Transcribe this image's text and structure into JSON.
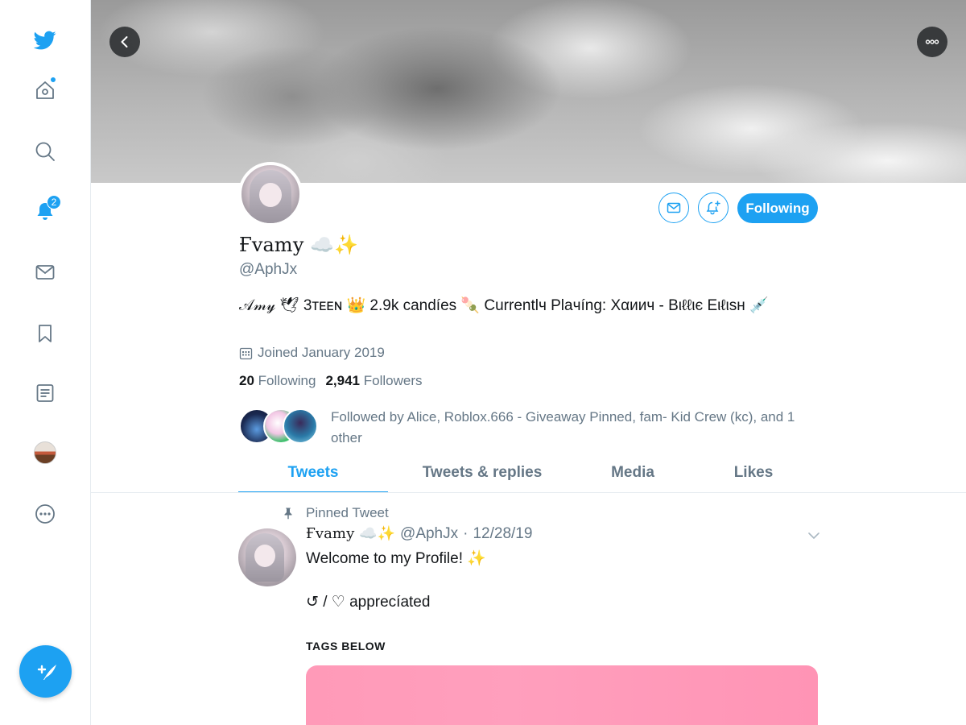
{
  "sidebar": {
    "notifications_badge": "2"
  },
  "profile": {
    "display_name": "Ғvаmу ☁️✨",
    "handle": "@AphJx",
    "bio": "𝒜𝓂𝓎 🕊 3ᴛᴇᴇɴ 👑 2.9k candíes 🍡 Currentlч Plaчíng: Xαиич - Bιℓℓιє Eιℓιѕн 💉",
    "joined": "Joined January 2019",
    "following_count": "20",
    "following_label": "Following",
    "followers_count": "2,941",
    "followers_label": "Followers",
    "followed_by": "Followed by Alice, Roblox.666 - Giveaway Pinned, fam- Kid Crew (kc), and 1 other",
    "follow_button": "Following"
  },
  "tabs": [
    {
      "label": "Tweets"
    },
    {
      "label": "Tweets & replies"
    },
    {
      "label": "Media"
    },
    {
      "label": "Likes"
    }
  ],
  "tweet": {
    "pinned_label": "Pinned Tweet",
    "name": "Ғvаmу ☁️✨",
    "handle": "@AphJx",
    "separator": "·",
    "date": "12/28/19",
    "text_line1": "Welcome to my Profile! ✨",
    "text_line2": "↺ / ♡ apprecíated",
    "tags_heading": "TAGS BELOW"
  },
  "colors": {
    "accent": "#1da1f2",
    "secondary_text": "#657786",
    "media_card": "#ff9ab8"
  },
  "icons": [
    "twitter-bird-icon",
    "home-icon",
    "search-icon",
    "bell-icon",
    "mail-icon",
    "bookmark-icon",
    "list-icon",
    "more-icon",
    "compose-icon",
    "back-arrow-icon",
    "ellipsis-icon",
    "calendar-icon",
    "pin-icon",
    "chevron-down-icon",
    "bell-plus-icon"
  ]
}
